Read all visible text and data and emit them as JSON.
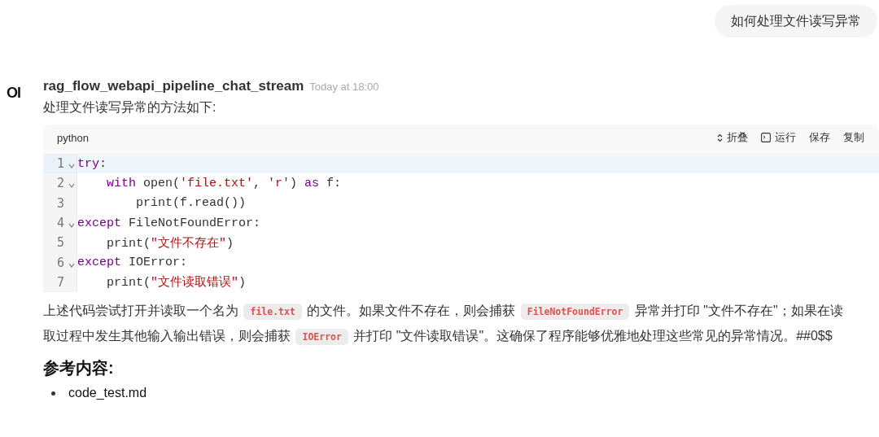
{
  "user_message": {
    "text": "如何处理文件读写异常"
  },
  "reply": {
    "avatar": "OI",
    "model": "rag_flow_webapi_pipeline_chat_stream",
    "time": "Today at 18:00",
    "intro": "处理文件读写异常的方法如下:",
    "code_block": {
      "language": "python",
      "actions": [
        {
          "kind": "fold",
          "label": "折叠"
        },
        {
          "kind": "run",
          "label": "运行"
        },
        {
          "kind": "save",
          "label": "保存"
        },
        {
          "kind": "copy",
          "label": "复制"
        }
      ],
      "lines": [
        {
          "number": "1",
          "foldable": true,
          "active": true,
          "tokens": [
            {
              "kind": "keyword",
              "text": "try"
            },
            {
              "kind": "plain",
              "text": ":"
            }
          ]
        },
        {
          "number": "2",
          "foldable": true,
          "active": false,
          "tokens": [
            {
              "kind": "keyword",
              "text": "    with"
            },
            {
              "kind": "plain",
              "text": " open("
            },
            {
              "kind": "string",
              "text": "'file.txt'"
            },
            {
              "kind": "plain",
              "text": ", "
            },
            {
              "kind": "string",
              "text": "'r'"
            },
            {
              "kind": "plain",
              "text": ") "
            },
            {
              "kind": "keyword",
              "text": "as"
            },
            {
              "kind": "plain",
              "text": " f:"
            }
          ]
        },
        {
          "number": "3",
          "foldable": false,
          "active": false,
          "tokens": [
            {
              "kind": "plain",
              "text": "        print(f.read())"
            }
          ]
        },
        {
          "number": "4",
          "foldable": true,
          "active": false,
          "tokens": [
            {
              "kind": "keyword",
              "text": "except"
            },
            {
              "kind": "plain",
              "text": " FileNotFoundError:"
            }
          ]
        },
        {
          "number": "5",
          "foldable": false,
          "active": false,
          "tokens": [
            {
              "kind": "plain",
              "text": "    print("
            },
            {
              "kind": "string",
              "text": "\"文件不存在\""
            },
            {
              "kind": "plain",
              "text": ")"
            }
          ]
        },
        {
          "number": "6",
          "foldable": true,
          "active": false,
          "tokens": [
            {
              "kind": "keyword",
              "text": "except"
            },
            {
              "kind": "plain",
              "text": " IOError:"
            }
          ]
        },
        {
          "number": "7",
          "foldable": false,
          "active": false,
          "tokens": [
            {
              "kind": "plain",
              "text": "    print("
            },
            {
              "kind": "string",
              "text": "\"文件读取错误\""
            },
            {
              "kind": "plain",
              "text": ")"
            }
          ]
        }
      ]
    },
    "explanation": [
      {
        "kind": "text",
        "text": "上述代码尝试打开并读取一个名为 "
      },
      {
        "kind": "code",
        "text": "file.txt"
      },
      {
        "kind": "text",
        "text": " 的文件。如果文件不存在，则会捕获 "
      },
      {
        "kind": "code",
        "text": "FileNotFoundError"
      },
      {
        "kind": "text",
        "text": " 异常并打印 \"文件不存在\"；如果在读取过程中发生其他输入输出错误，则会捕获 "
      },
      {
        "kind": "code",
        "text": "IOError"
      },
      {
        "kind": "text",
        "text": " 并打印 \"文件读取错误\"。这确保了程序能够优雅地处理这些常见的异常情况。##0$$"
      }
    ],
    "references": {
      "heading": "参考内容:",
      "items": [
        "code_test.md"
      ]
    }
  }
}
